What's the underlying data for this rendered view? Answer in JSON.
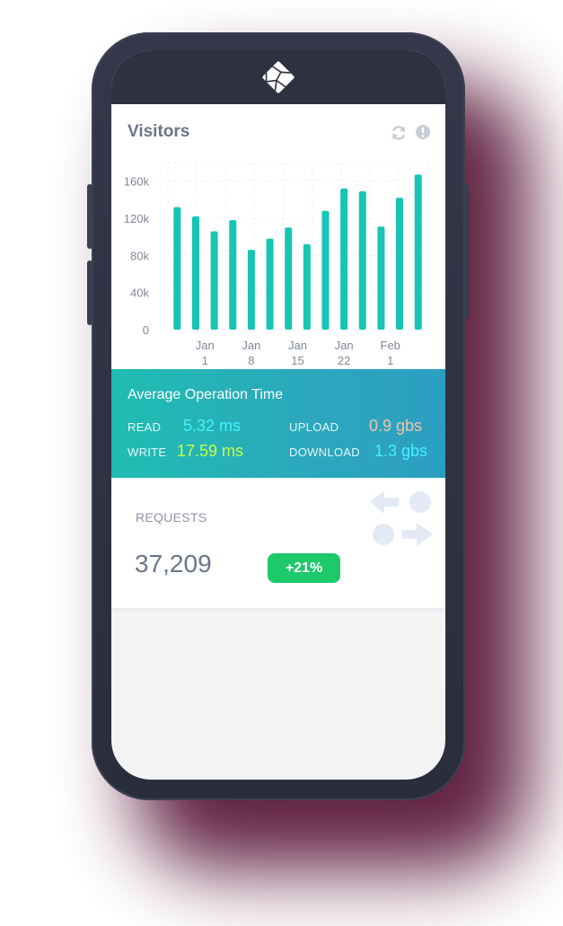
{
  "visitors": {
    "title": "Visitors",
    "icons": [
      "refresh-icon",
      "alert-icon"
    ]
  },
  "chart_data": {
    "type": "bar",
    "values": [
      132000,
      122000,
      106000,
      118000,
      86000,
      98000,
      110000,
      92000,
      128000,
      152000,
      149000,
      111000,
      142000,
      167000
    ],
    "ylim": [
      0,
      180000
    ],
    "yticks": [
      "0",
      "40k",
      "80k",
      "120k",
      "160k"
    ],
    "ytick_values": [
      0,
      40000,
      80000,
      120000,
      160000
    ],
    "xticks": [
      {
        "month": "Jan",
        "day": "1"
      },
      {
        "month": "Jan",
        "day": "8"
      },
      {
        "month": "Jan",
        "day": "15"
      },
      {
        "month": "Jan",
        "day": "22"
      },
      {
        "month": "Feb",
        "day": "1"
      }
    ],
    "xtick_index": [
      1.5,
      4,
      6.5,
      9,
      11.5
    ],
    "grid": true,
    "bar_color": "#16c5b3"
  },
  "operation": {
    "title": "Average Operation Time",
    "read_label": "READ",
    "read_value": "5.32 ms",
    "upload_label": "UPLOAD",
    "upload_value": "0.9 gbs",
    "write_label": "WRITE",
    "write_value": "17.59 ms",
    "download_label": "DOWNLOAD",
    "download_value": "1.3 gbs",
    "colors": {
      "read": "#45f2ff",
      "upload": "#f2c4a6",
      "write": "#c7ff4a",
      "download": "#45f2ff"
    }
  },
  "requests": {
    "label": "REQUESTS",
    "value": "37,209",
    "change": "+21%",
    "icon": "transfer-arrows-icon"
  }
}
